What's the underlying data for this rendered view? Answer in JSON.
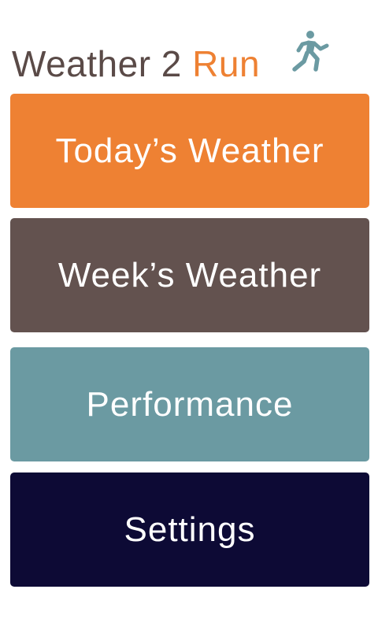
{
  "header": {
    "title_main": "Weather 2 ",
    "title_accent": "Run",
    "logo_icon": "runner-icon"
  },
  "menu": {
    "items": [
      {
        "label": "Today’s Weather",
        "color": "#ee8133"
      },
      {
        "label": "Week’s Weather",
        "color": "#63524f"
      },
      {
        "label": "Performance",
        "color": "#6b9aa2"
      },
      {
        "label": "Settings",
        "color": "#0d0a35"
      }
    ]
  },
  "colors": {
    "title_text": "#5a4a47",
    "accent": "#ee8133",
    "icon": "#6b9aa2",
    "background": "#ffffff"
  }
}
